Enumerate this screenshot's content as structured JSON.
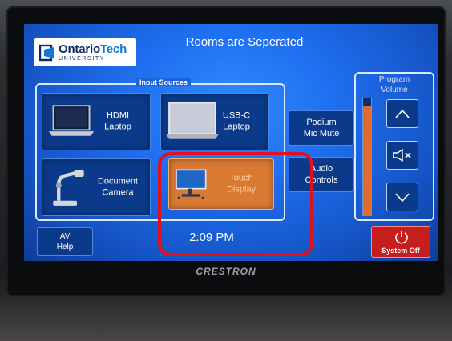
{
  "header": {
    "logo": {
      "name_part1": "Ontario",
      "name_part2": "Tech",
      "sub": "UNIVERSITY"
    },
    "title": "Rooms are Seperated"
  },
  "input_sources": {
    "label": "Input Sources",
    "tiles": [
      {
        "line1": "HDMI",
        "line2": "Laptop",
        "icon": "laptop-icon"
      },
      {
        "line1": "USB-C",
        "line2": "Laptop",
        "icon": "laptop-icon"
      },
      {
        "line1": "Document",
        "line2": "Camera",
        "icon": "document-camera-icon"
      },
      {
        "line1": "Touch",
        "line2": "Display",
        "icon": "touch-display-icon"
      }
    ]
  },
  "side_buttons": {
    "podium": {
      "line1": "Podium",
      "line2": "Mic Mute"
    },
    "audio": {
      "line1": "Audio",
      "line2": "Controls"
    }
  },
  "volume": {
    "title_line1": "Program",
    "title_line2": "Volume",
    "level": 0.94,
    "up_icon": "chevron-up-icon",
    "mute_icon": "speaker-mute-icon",
    "down_icon": "chevron-down-icon"
  },
  "footer": {
    "av_help": {
      "line1": "AV",
      "line2": "Help"
    },
    "time": "2:09 PM",
    "system_off": "System Off"
  },
  "device_brand": "CRESTRON",
  "colors": {
    "screen_blue": "#1f6ff0",
    "tile_blue": "#0b3a8a",
    "highlight_red": "#e0101e",
    "system_off_red": "#c61d1d",
    "volume_fill": "#e06a30",
    "touch_tile": "#d97a33"
  }
}
